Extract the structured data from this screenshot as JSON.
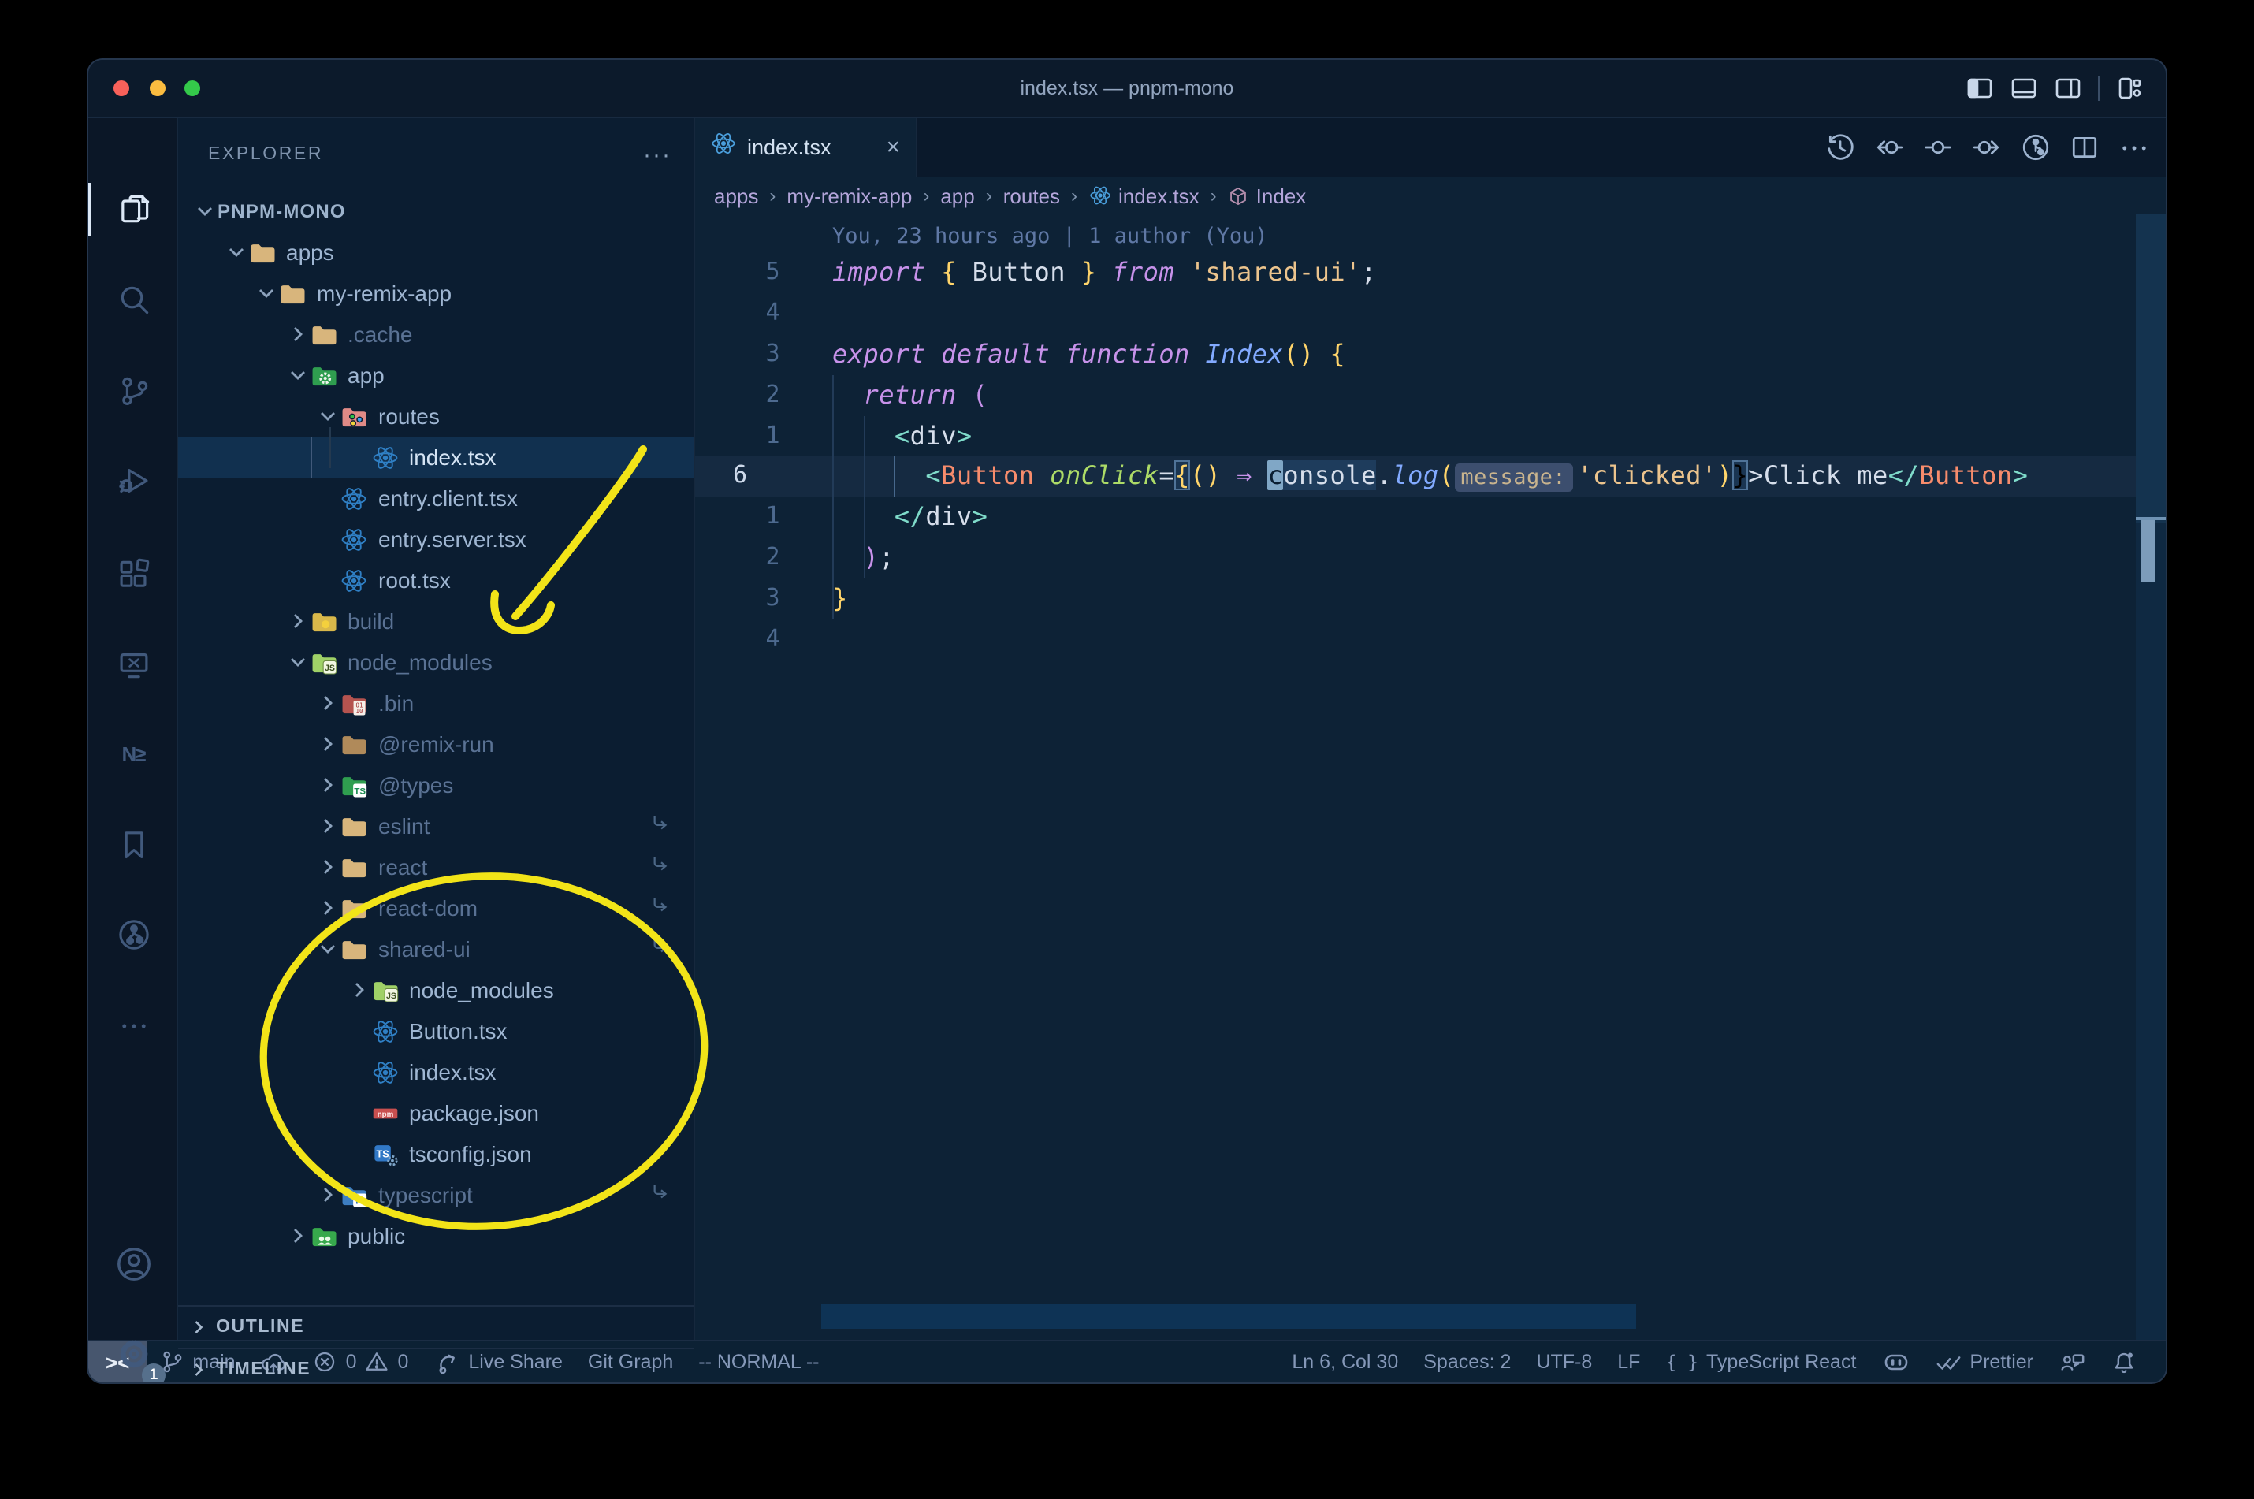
{
  "window": {
    "title": "index.tsx — pnpm-mono"
  },
  "titlebar": {
    "traffic_lights": {
      "close": "#f9615a",
      "minimize": "#fbbc40",
      "zoom": "#34c94a"
    },
    "layout_icons": [
      "toggle-primary-sidebar",
      "toggle-panel",
      "toggle-secondary-sidebar",
      "customize-layout"
    ]
  },
  "activity_bar": {
    "items": [
      {
        "name": "explorer",
        "icon": "files-icon",
        "active": true
      },
      {
        "name": "search",
        "icon": "search-icon",
        "active": false
      },
      {
        "name": "source-control",
        "icon": "source-control-icon",
        "active": false
      },
      {
        "name": "run-debug",
        "icon": "run-debug-icon",
        "active": false
      },
      {
        "name": "extensions",
        "icon": "extensions-icon",
        "active": false
      },
      {
        "name": "remote-explorer",
        "icon": "remote-explorer-icon",
        "active": false
      },
      {
        "name": "nx-console",
        "icon": "nx-icon",
        "active": false
      },
      {
        "name": "bookmarks",
        "icon": "bookmark-icon",
        "active": false
      },
      {
        "name": "git-graph",
        "icon": "git-graph-icon",
        "active": false
      },
      {
        "name": "more-views",
        "icon": "more-icon",
        "active": false
      }
    ],
    "bottom": [
      {
        "name": "account",
        "icon": "account-icon"
      },
      {
        "name": "settings",
        "icon": "gear-icon",
        "badge": "1"
      }
    ]
  },
  "explorer": {
    "header": "EXPLORER",
    "more_label": "···",
    "sections": {
      "outline": "OUTLINE",
      "timeline": "TIMELINE"
    },
    "tree": [
      {
        "label": "PNPM-MONO",
        "level": 0,
        "chevron": "down",
        "icon": "none",
        "root": true
      },
      {
        "label": "apps",
        "level": 1,
        "chevron": "down",
        "icon": "folder-tan"
      },
      {
        "label": "my-remix-app",
        "level": 2,
        "chevron": "down",
        "icon": "folder-tan"
      },
      {
        "label": ".cache",
        "level": 3,
        "chevron": "right",
        "icon": "folder-tan",
        "dim": true
      },
      {
        "label": "app",
        "level": 3,
        "chevron": "down",
        "icon": "folder-app"
      },
      {
        "label": "routes",
        "level": 4,
        "chevron": "down",
        "icon": "folder-routes"
      },
      {
        "label": "index.tsx",
        "level": 5,
        "chevron": "none",
        "icon": "react",
        "selected": true
      },
      {
        "label": "entry.client.tsx",
        "level": 4,
        "chevron": "none",
        "icon": "react"
      },
      {
        "label": "entry.server.tsx",
        "level": 4,
        "chevron": "none",
        "icon": "react"
      },
      {
        "label": "root.tsx",
        "level": 4,
        "chevron": "none",
        "icon": "react"
      },
      {
        "label": "build",
        "level": 3,
        "chevron": "right",
        "icon": "folder-build",
        "dim": true
      },
      {
        "label": "node_modules",
        "level": 3,
        "chevron": "down",
        "icon": "folder-js",
        "dim": true
      },
      {
        "label": ".bin",
        "level": 4,
        "chevron": "right",
        "icon": "folder-bin",
        "dim": true
      },
      {
        "label": "@remix-run",
        "level": 4,
        "chevron": "right",
        "icon": "folder-brown",
        "dim": true
      },
      {
        "label": "@types",
        "level": 4,
        "chevron": "right",
        "icon": "folder-types",
        "dim": true
      },
      {
        "label": "eslint",
        "level": 4,
        "chevron": "right",
        "icon": "folder-tan",
        "dim": true,
        "symlink": true
      },
      {
        "label": "react",
        "level": 4,
        "chevron": "right",
        "icon": "folder-tan",
        "dim": true,
        "symlink": true
      },
      {
        "label": "react-dom",
        "level": 4,
        "chevron": "right",
        "icon": "folder-tan",
        "dim": true,
        "symlink": true
      },
      {
        "label": "shared-ui",
        "level": 4,
        "chevron": "down",
        "icon": "folder-tan",
        "dim": true,
        "symlink": true
      },
      {
        "label": "node_modules",
        "level": 5,
        "chevron": "right",
        "icon": "folder-js"
      },
      {
        "label": "Button.tsx",
        "level": 5,
        "chevron": "none",
        "icon": "react"
      },
      {
        "label": "index.tsx",
        "level": 5,
        "chevron": "none",
        "icon": "react"
      },
      {
        "label": "package.json",
        "level": 5,
        "chevron": "none",
        "icon": "npm"
      },
      {
        "label": "tsconfig.json",
        "level": 5,
        "chevron": "none",
        "icon": "ts-gear"
      },
      {
        "label": "typescript",
        "level": 4,
        "chevron": "right",
        "icon": "folder-ts",
        "dim": true,
        "symlink": true
      },
      {
        "label": "public",
        "level": 3,
        "chevron": "right",
        "icon": "folder-public"
      }
    ]
  },
  "tab": {
    "label": "index.tsx",
    "icon": "react-icon",
    "close": "×"
  },
  "editor_actions": [
    "history-icon",
    "prev-change-icon",
    "change-icon",
    "next-change-icon",
    "git-graph-circle-icon",
    "split-editor-icon",
    "more-icon"
  ],
  "breadcrumbs": [
    {
      "label": "apps"
    },
    {
      "label": "my-remix-app"
    },
    {
      "label": "app"
    },
    {
      "label": "routes"
    },
    {
      "label": "index.tsx",
      "icon": "react"
    },
    {
      "label": "Index",
      "icon": "symbol-cube"
    }
  ],
  "editor": {
    "blame": "You, 23 hours ago | 1 author (You)",
    "gutter": [
      "5",
      "4",
      "3",
      "2",
      "1",
      "6",
      "1",
      "2",
      "3",
      "4"
    ],
    "current_line_index": 5,
    "current_line_number": "6",
    "lines": [
      [
        {
          "t": "import ",
          "c": "kw"
        },
        {
          "t": "{",
          "c": "gold"
        },
        {
          "t": " Button ",
          "c": "txt"
        },
        {
          "t": "}",
          "c": "gold"
        },
        {
          "t": " "
        },
        {
          "t": "from",
          "c": "kw"
        },
        {
          "t": " "
        },
        {
          "t": "'shared-ui'",
          "c": "str"
        },
        {
          "t": ";",
          "c": "txt"
        }
      ],
      [],
      [
        {
          "t": "export",
          "c": "kw"
        },
        {
          "t": " "
        },
        {
          "t": "default",
          "c": "kw"
        },
        {
          "t": " "
        },
        {
          "t": "function",
          "c": "kw"
        },
        {
          "t": " "
        },
        {
          "t": "Index",
          "c": "fn"
        },
        {
          "t": "()",
          "c": "gold"
        },
        {
          "t": " "
        },
        {
          "t": "{",
          "c": "gold"
        }
      ],
      [
        {
          "t": "  "
        },
        {
          "t": "return",
          "c": "kw"
        },
        {
          "t": " "
        },
        {
          "t": "(",
          "c": "pink"
        }
      ],
      [
        {
          "t": "    "
        },
        {
          "t": "<",
          "c": "tag"
        },
        {
          "t": "div",
          "c": "txt"
        },
        {
          "t": ">",
          "c": "tag"
        }
      ],
      [
        {
          "t": "      "
        },
        {
          "t": "<",
          "c": "tag"
        },
        {
          "t": "Button",
          "c": "comp"
        },
        {
          "t": " "
        },
        {
          "t": "onClick",
          "c": "attr"
        },
        {
          "t": "=",
          "c": "txt"
        },
        {
          "t": "{",
          "c": "gold bracket"
        },
        {
          "t": "()",
          "c": "gold"
        },
        {
          "t": " "
        },
        {
          "t": "⇒",
          "c": "arrow"
        },
        {
          "t": " "
        },
        {
          "t": "c",
          "c": "txt cursor"
        },
        {
          "t": "onsole",
          "c": "txt word"
        },
        {
          "t": ".",
          "c": "txt"
        },
        {
          "t": "log",
          "c": "fn"
        },
        {
          "t": "(",
          "c": "gold"
        },
        {
          "t": "message:",
          "c": "inlay"
        },
        {
          "t": "'clicked'",
          "c": "str"
        },
        {
          "t": ")",
          "c": "gold"
        },
        {
          "t": "}",
          "c": "lblue bracket"
        },
        {
          "t": ">",
          "c": "txt"
        },
        {
          "t": "Click me",
          "c": "txt"
        },
        {
          "t": "</",
          "c": "tag"
        },
        {
          "t": "Button",
          "c": "comp"
        },
        {
          "t": ">",
          "c": "tag"
        }
      ],
      [
        {
          "t": "    "
        },
        {
          "t": "</",
          "c": "tag"
        },
        {
          "t": "div",
          "c": "txt"
        },
        {
          "t": ">",
          "c": "tag"
        }
      ],
      [
        {
          "t": "  "
        },
        {
          "t": ")",
          "c": "pink"
        },
        {
          "t": ";",
          "c": "txt"
        }
      ],
      [
        {
          "t": "}",
          "c": "gold"
        }
      ],
      []
    ]
  },
  "status_bar": {
    "left": [
      {
        "name": "remote-indicator",
        "icon": "remote-glyph",
        "text": "><"
      },
      {
        "name": "git-branch",
        "icon": "branch-icon",
        "text": "main"
      },
      {
        "name": "sync",
        "icon": "cloud-upload-icon",
        "text": ""
      },
      {
        "name": "problems",
        "icon": "error-icon",
        "text": "0",
        "icon2": "warning-icon",
        "text2": "0"
      },
      {
        "name": "live-share",
        "icon": "liveshare-icon",
        "text": "Live Share"
      },
      {
        "name": "git-graph",
        "text": "Git Graph"
      },
      {
        "name": "vim-mode",
        "text": "-- NORMAL --"
      }
    ],
    "right": [
      {
        "name": "cursor-position",
        "text": "Ln 6, Col 30"
      },
      {
        "name": "indentation",
        "text": "Spaces: 2"
      },
      {
        "name": "encoding",
        "text": "UTF-8"
      },
      {
        "name": "eol",
        "text": "LF"
      },
      {
        "name": "language-mode",
        "icon": "braces-icon",
        "text": "TypeScript React"
      },
      {
        "name": "copilot",
        "icon": "copilot-icon",
        "text": ""
      },
      {
        "name": "formatter",
        "icon": "double-check-icon",
        "text": "Prettier"
      },
      {
        "name": "feedback",
        "icon": "feedback-icon",
        "text": ""
      },
      {
        "name": "notifications",
        "icon": "bell-icon",
        "text": ""
      }
    ]
  },
  "annotations": {
    "color": "#f2e418",
    "shapes": [
      "arrow-to-node_modules",
      "circle-around-shared-ui"
    ]
  }
}
